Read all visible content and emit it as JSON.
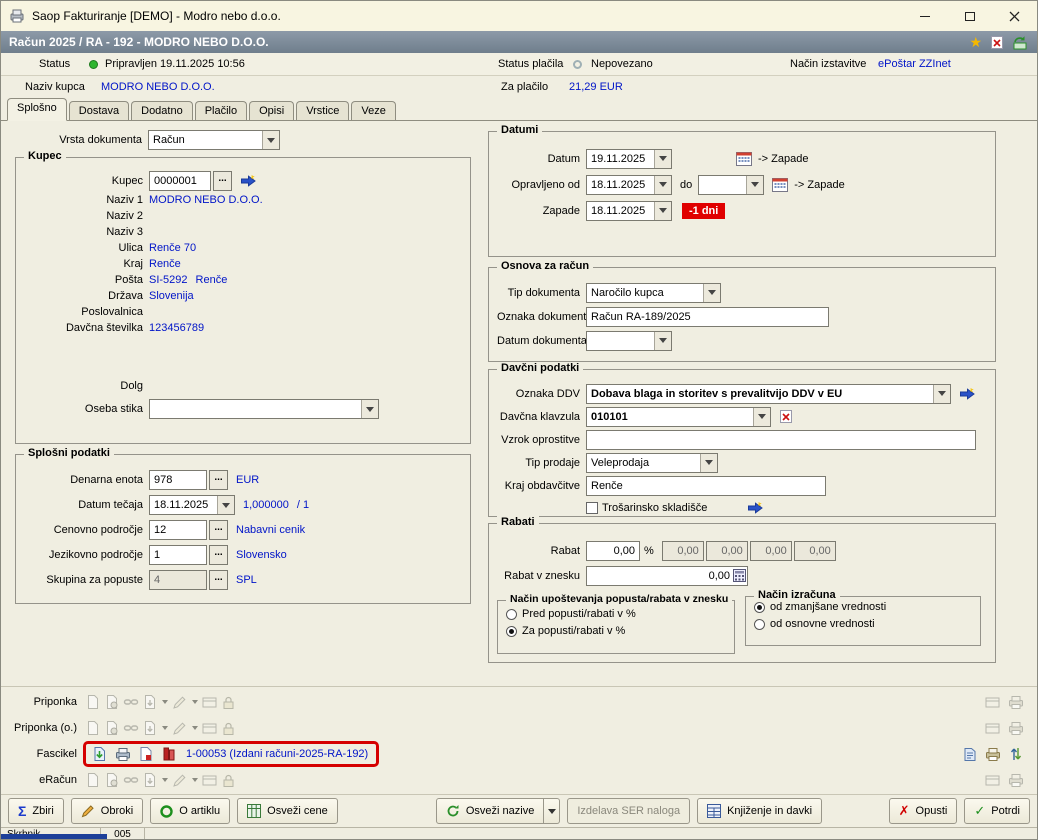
{
  "titlebar": {
    "title": "Saop Fakturiranje [DEMO] - Modro nebo d.o.o."
  },
  "header": {
    "title": "Račun  2025 / RA - 192 - MODRO NEBO D.O.O."
  },
  "status_row": {
    "status_label": "Status",
    "status_value": "Pripravljen 19.11.2025 10:56",
    "payment_status_label": "Status plačila",
    "payment_status_value": "Nepovezano",
    "issue_label": "Način izstavitve",
    "issue_value": "ePoštar ZZInet"
  },
  "customer_row": {
    "label": "Naziv kupca",
    "value": "MODRO NEBO D.O.O.",
    "pay_label": "Za plačilo",
    "pay_value": "21,29 EUR"
  },
  "tabs": {
    "items": [
      "Splošno",
      "Dostava",
      "Dodatno",
      "Plačilo",
      "Opisi",
      "Vrstice",
      "Veze"
    ]
  },
  "vrsta": {
    "label": "Vrsta dokumenta",
    "value": "Račun"
  },
  "kupec": {
    "group_title": "Kupec",
    "kupec_label": "Kupec",
    "kupec_value": "0000001",
    "naziv1_label": "Naziv 1",
    "naziv1_value": "MODRO NEBO D.O.O.",
    "naziv2_label": "Naziv 2",
    "naziv3_label": "Naziv 3",
    "ulica_label": "Ulica",
    "ulica_value": "Renče 70",
    "kraj_label": "Kraj",
    "kraj_value": "Renče",
    "posta_label": "Pošta",
    "posta_code": "SI-5292",
    "posta_city": "Renče",
    "drzava_label": "Država",
    "drzava_value": "Slovenija",
    "poslovalnica_label": "Poslovalnica",
    "davcna_label": "Davčna številka",
    "davcna_value": "123456789",
    "dolg_label": "Dolg",
    "oseba_label": "Oseba stika"
  },
  "splosni": {
    "group_title": "Splošni podatki",
    "denarna_label": "Denarna enota",
    "denarna_value": "978",
    "denarna_currency": "EUR",
    "tecaj_label": "Datum tečaja",
    "tecaj_value": "18.11.2025",
    "tecaj_rate": "1,000000",
    "tecaj_ratio": "/ 1",
    "cenovno_label": "Cenovno področje",
    "cenovno_value": "12",
    "cenovno_name": "Nabavni cenik",
    "jezik_label": "Jezikovno področje",
    "jezik_value": "1",
    "jezik_name": "Slovensko",
    "popusti_label": "Skupina za popuste",
    "popusti_value": "4",
    "popusti_name": "SPL"
  },
  "datumi": {
    "group_title": "Datumi",
    "datum_label": "Datum",
    "datum_value": "19.11.2025",
    "zapade_link": "-> Zapade",
    "opravljeno_label": "Opravljeno od",
    "opravljeno_value": "18.11.2025",
    "do_label": "do",
    "zapade_label": "Zapade",
    "zapade_value": "18.11.2025",
    "overdue_badge": "-1 dni"
  },
  "osnova": {
    "group_title": "Osnova za račun",
    "tip_label": "Tip dokumenta",
    "tip_value": "Naročilo kupca",
    "oznaka_label": "Oznaka dokumenta",
    "oznaka_value": "Račun RA-189/2025",
    "datum_label": "Datum dokumenta"
  },
  "davcni": {
    "group_title": "Davčni podatki",
    "ddv_label": "Oznaka DDV",
    "ddv_value": "Dobava blaga in storitev s prevalitvijo DDV v EU",
    "klavzula_label": "Davčna klavzula",
    "klavzula_value": "010101",
    "vzrok_label": "Vzrok oprostitve",
    "tip_label": "Tip prodaje",
    "tip_value": "Veleprodaja",
    "kraj_label": "Kraj obdavčitve",
    "kraj_value": "Renče",
    "trosarinsko_label": "Trošarinsko skladišče"
  },
  "rabati": {
    "group_title": "Rabati",
    "rabat_label": "Rabat",
    "rabat_value": "0,00",
    "percent": "%",
    "extra_values": [
      "0,00",
      "0,00",
      "0,00",
      "0,00"
    ],
    "znesek_label": "Rabat v znesku",
    "znesek_value": "0,00",
    "nacin_title": "Način upoštevanja popusta/rabata v znesku",
    "nacin_opt1": "Pred popusti/rabati v %",
    "nacin_opt2": "Za popusti/rabati v %",
    "izracun_title": "Način izračuna",
    "izracun_opt1": "od zmanjšane vrednosti",
    "izracun_opt2": "od osnovne vrednosti"
  },
  "attachments": {
    "priponka_label": "Priponka",
    "priponka_o_label": "Priponka (o.)",
    "fascikel_label": "Fascikel",
    "fascikel_link": "1-00053 (Izdani računi-2025-RA-192)",
    "eracun_label": "eRačun"
  },
  "toolbar": {
    "zbiri": "Zbiri",
    "obroki": "Obroki",
    "o_artiklu": "O artiklu",
    "osvezi_cene": "Osveži cene",
    "osvezi_nazive": "Osveži nazive",
    "izdelava_ser": "Izdelava SER naloga",
    "knjizenje": "Knjiženje in davki",
    "opusti": "Opusti",
    "potrdi": "Potrdi"
  },
  "statusbar": {
    "user": "Skrbnik",
    "code": "005"
  },
  "icons": {
    "star": "★",
    "sigma": "Σ",
    "check": "✓",
    "cross": "✗",
    "dots": "..."
  },
  "colors": {
    "link_blue": "#0014C8",
    "badge_red": "#E00000",
    "status_green": "#2FB52F",
    "header_bg": "#7D8C9B",
    "highlight_red": "#D50000"
  }
}
